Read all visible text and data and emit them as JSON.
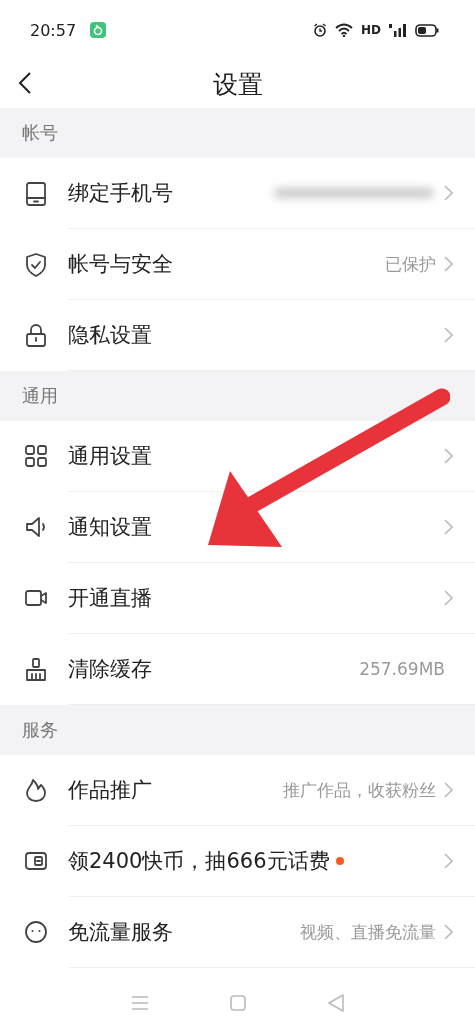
{
  "status_bar": {
    "time": "20:57",
    "network": "HD"
  },
  "header": {
    "title": "设置"
  },
  "sections": [
    {
      "title": "帐号",
      "items": [
        {
          "kind": "phone",
          "label": "绑定手机号",
          "redacted": true
        },
        {
          "kind": "shield",
          "label": "帐号与安全",
          "value": "已保护"
        },
        {
          "kind": "lock",
          "label": "隐私设置"
        }
      ]
    },
    {
      "title": "通用",
      "items": [
        {
          "kind": "grid",
          "label": "通用设置"
        },
        {
          "kind": "speaker",
          "label": "通知设置"
        },
        {
          "kind": "camera",
          "label": "开通直播"
        },
        {
          "kind": "brush",
          "label": "清除缓存",
          "value": "257.69MB",
          "no_chevron": true
        }
      ]
    },
    {
      "title": "服务",
      "items": [
        {
          "kind": "flame",
          "label": "作品推广",
          "value": "推广作品，收获粉丝"
        },
        {
          "kind": "wallet",
          "label": "领2400快币，抽666元话费",
          "dot": true
        },
        {
          "kind": "face",
          "label": "免流量服务",
          "value": "视频、直播免流量"
        }
      ]
    }
  ],
  "annotation": {
    "kind": "arrow"
  }
}
